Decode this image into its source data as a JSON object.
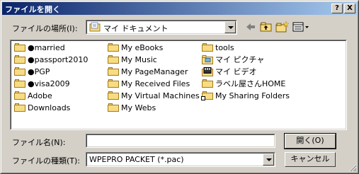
{
  "window": {
    "title": "ファイルを開く"
  },
  "titlebar_buttons": {
    "help": "?",
    "close": "X"
  },
  "location": {
    "label": "ファイルの場所(I):",
    "value": "マイ ドキュメント"
  },
  "files": [
    {
      "name": "●married",
      "icon": "folder-icon"
    },
    {
      "name": "●passport2010",
      "icon": "folder-icon"
    },
    {
      "name": "●PGP",
      "icon": "folder-icon"
    },
    {
      "name": "●visa2009",
      "icon": "folder-icon"
    },
    {
      "name": "Adobe",
      "icon": "folder-icon"
    },
    {
      "name": "Downloads",
      "icon": "folder-icon"
    },
    {
      "name": "My eBooks",
      "icon": "folder-icon"
    },
    {
      "name": "My Music",
      "icon": "folder-icon"
    },
    {
      "name": "My PageManager",
      "icon": "folder-icon"
    },
    {
      "name": "My Received Files",
      "icon": "folder-icon"
    },
    {
      "name": "My Virtual Machines",
      "icon": "folder-icon"
    },
    {
      "name": "My Webs",
      "icon": "folder-icon"
    },
    {
      "name": "tools",
      "icon": "folder-icon"
    },
    {
      "name": "マイ ピクチャ",
      "icon": "pictures-folder-icon"
    },
    {
      "name": "マイ ビデオ",
      "icon": "video-folder-icon"
    },
    {
      "name": "ラベル屋さんHOME",
      "icon": "folder-icon"
    },
    {
      "name": "My Sharing Folders",
      "icon": "shared-folder-icon"
    }
  ],
  "filename": {
    "label": "ファイル名(N):",
    "value": ""
  },
  "filetype": {
    "label": "ファイルの種類(T):",
    "value": "WPEPRO PACKET  (*.pac)"
  },
  "buttons": {
    "open": "開く(O)",
    "cancel": "キャンセル"
  }
}
